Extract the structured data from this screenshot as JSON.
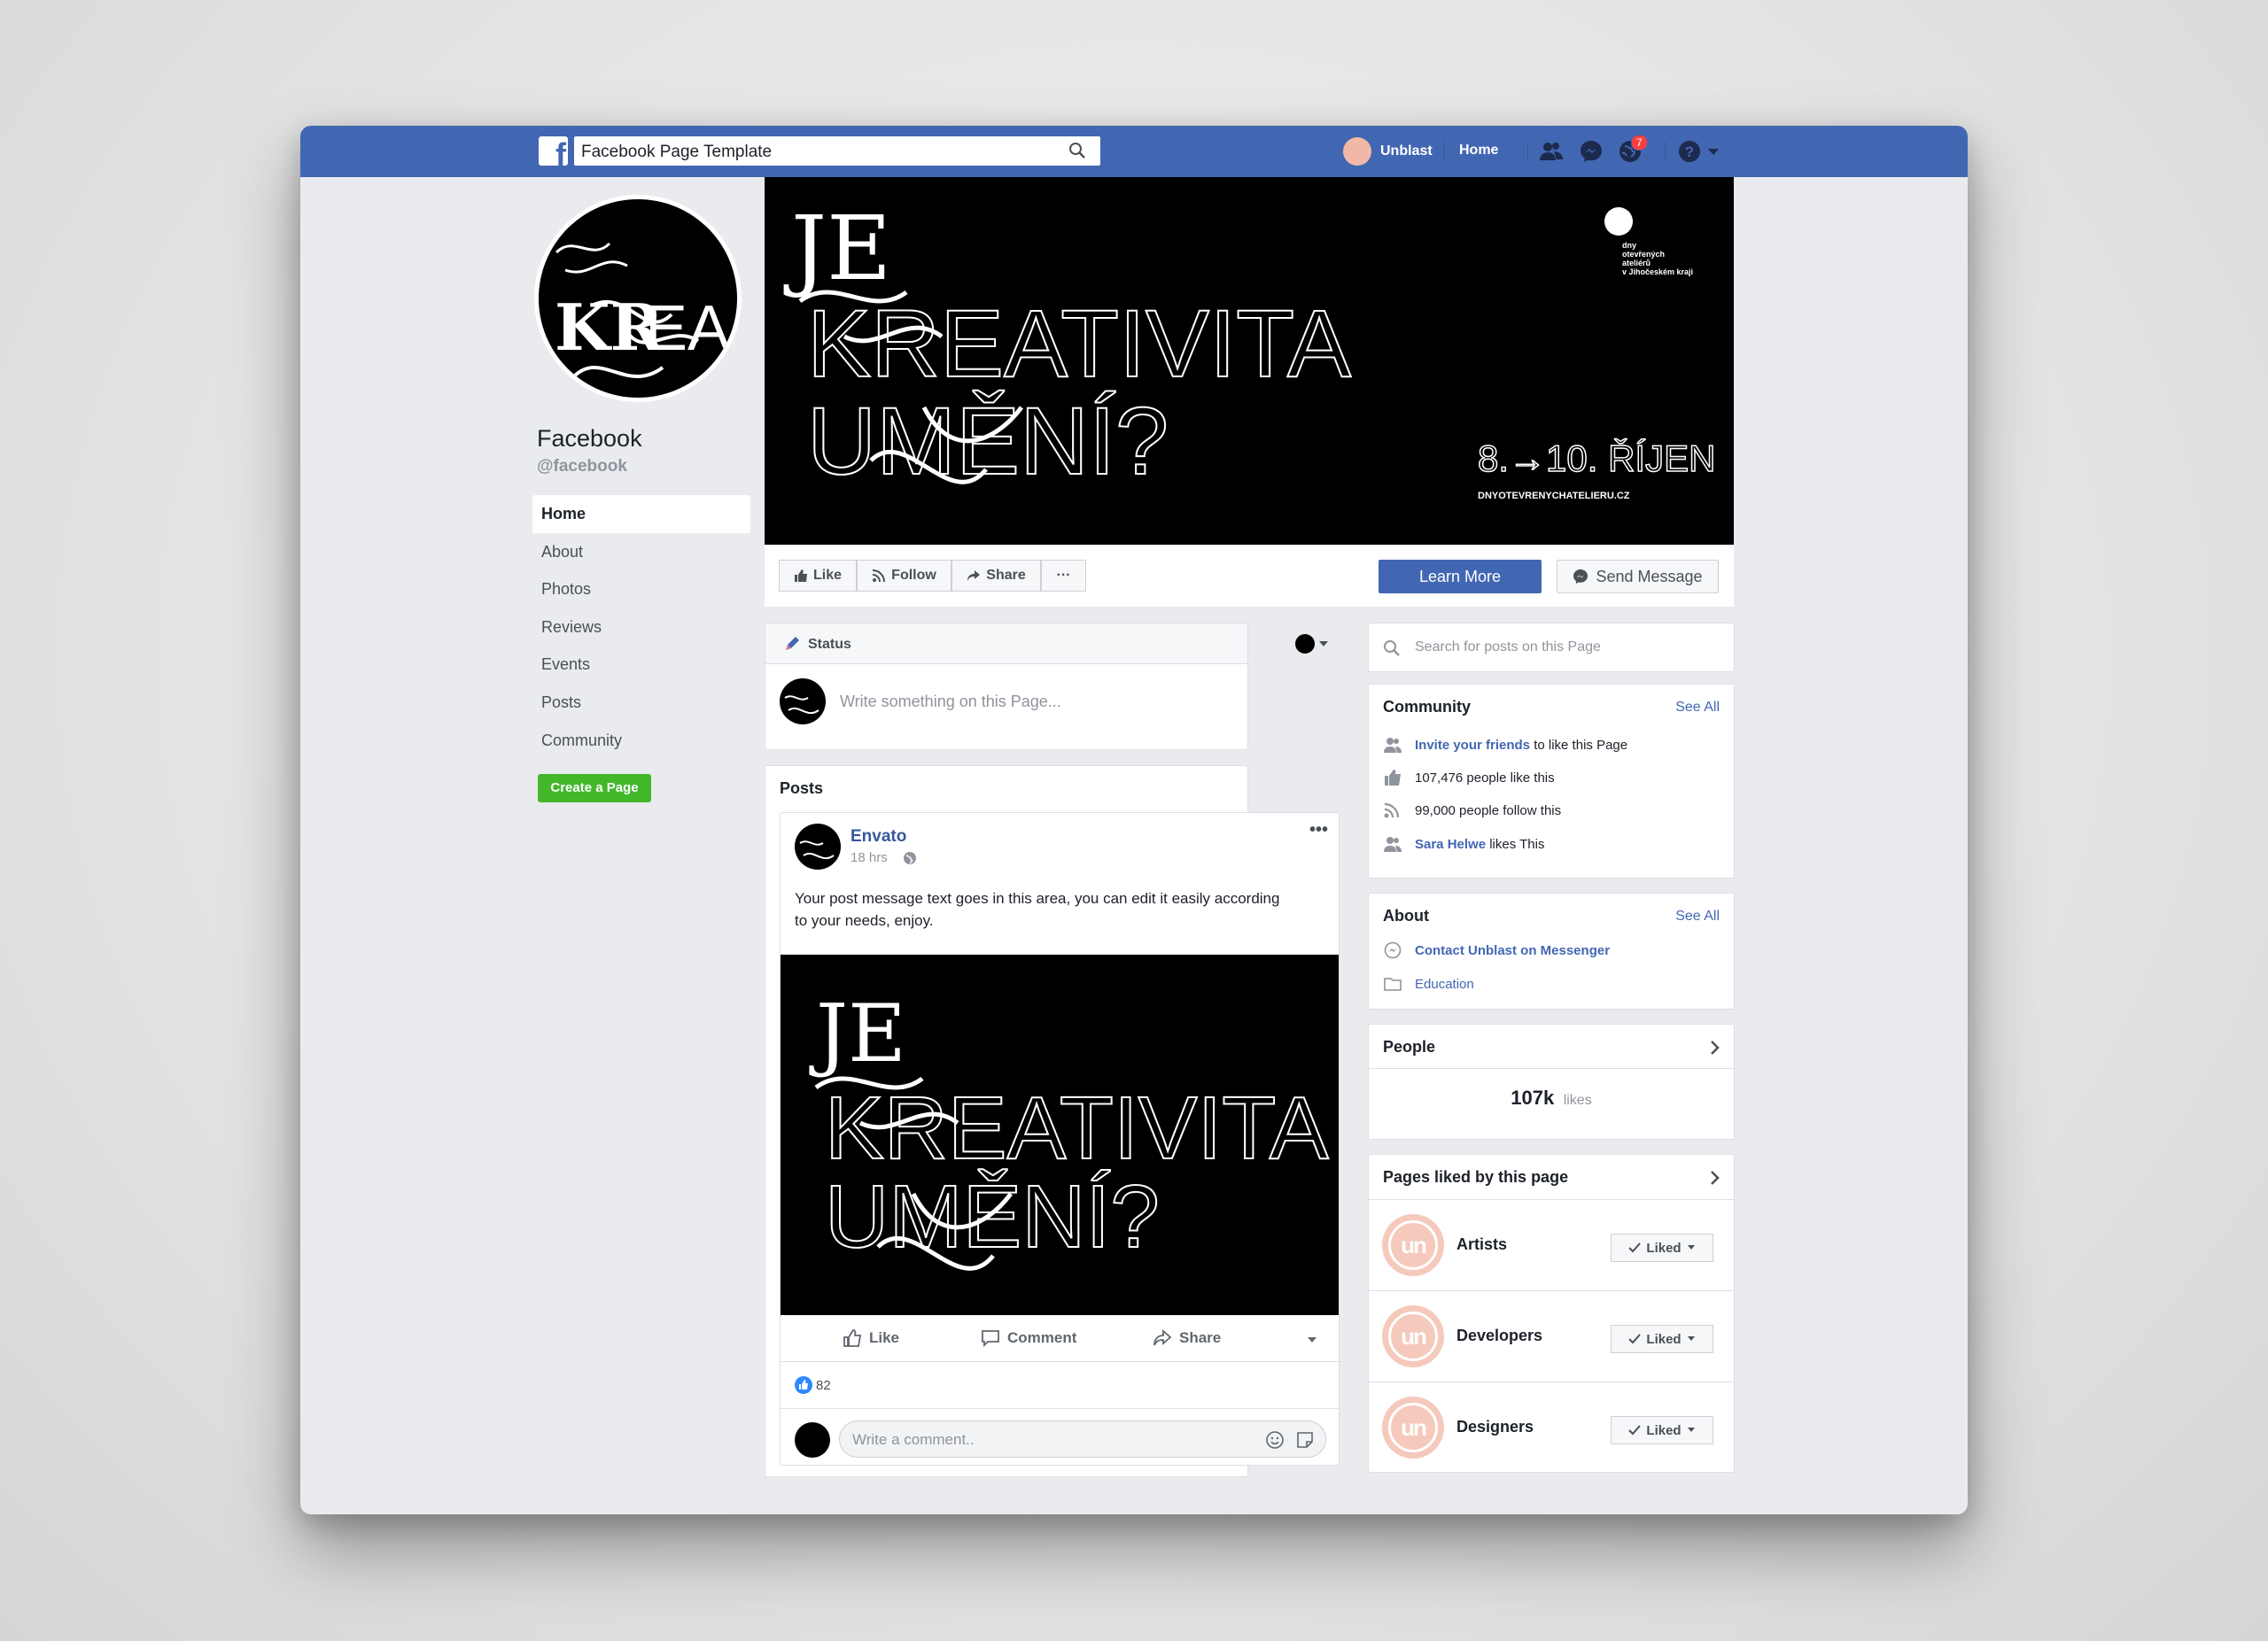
{
  "topbar": {
    "search_value": "Facebook Page Template",
    "user_name": "Unblast",
    "home_label": "Home",
    "notification_count": "7",
    "brand_color": "#4267b2"
  },
  "profile": {
    "name": "Facebook",
    "handle": "@facebook"
  },
  "nav": {
    "items": [
      "Home",
      "About",
      "Photos",
      "Reviews",
      "Events",
      "Posts",
      "Community"
    ],
    "create_page": "Create a Page"
  },
  "cover": {
    "line1": "JE",
    "line2": "KREATIVITA",
    "line3": "UMĚNÍ?",
    "dates": "8.→10. ŘÍJEN",
    "url": "DNYOTEVRENYCHATELIERU.CZ",
    "logo_lines": [
      "dny",
      "otevřených",
      "ateliérů",
      "v Jihočeském kraji"
    ]
  },
  "actions": {
    "like": "Like",
    "follow": "Follow",
    "share": "Share",
    "more": "···",
    "learn_more": "Learn More",
    "send_message": "Send Message"
  },
  "composer": {
    "status_label": "Status",
    "placeholder": "Write something on this Page..."
  },
  "posts": {
    "title": "Posts",
    "author": "Envato",
    "time": "18 hrs",
    "message": "Your post message text goes in this area, you can edit it easily according to your needs, enjoy.",
    "like": "Like",
    "comment": "Comment",
    "share": "Share",
    "reactions": "82",
    "comment_placeholder": "Write a comment.."
  },
  "sidebar": {
    "search_placeholder": "Search for posts on this Page",
    "community": {
      "title": "Community",
      "see_all": "See All",
      "invite_link": "Invite your friends",
      "invite_rest": "to like this Page",
      "likes": "107,476 people like this",
      "follows": "99,000 people follow this",
      "friend_name": "Sara Helwe",
      "friend_rest": "likes This"
    },
    "about": {
      "title": "About",
      "see_all": "See All",
      "messenger": "Contact Unblast on Messenger",
      "category": "Education"
    },
    "people": {
      "title": "People",
      "count": "107k",
      "unit": "likes"
    },
    "liked_pages": {
      "title": "Pages liked by this page",
      "button": "Liked",
      "avatar_text": "un",
      "items": [
        "Artists",
        "Developers",
        "Designers"
      ]
    }
  }
}
